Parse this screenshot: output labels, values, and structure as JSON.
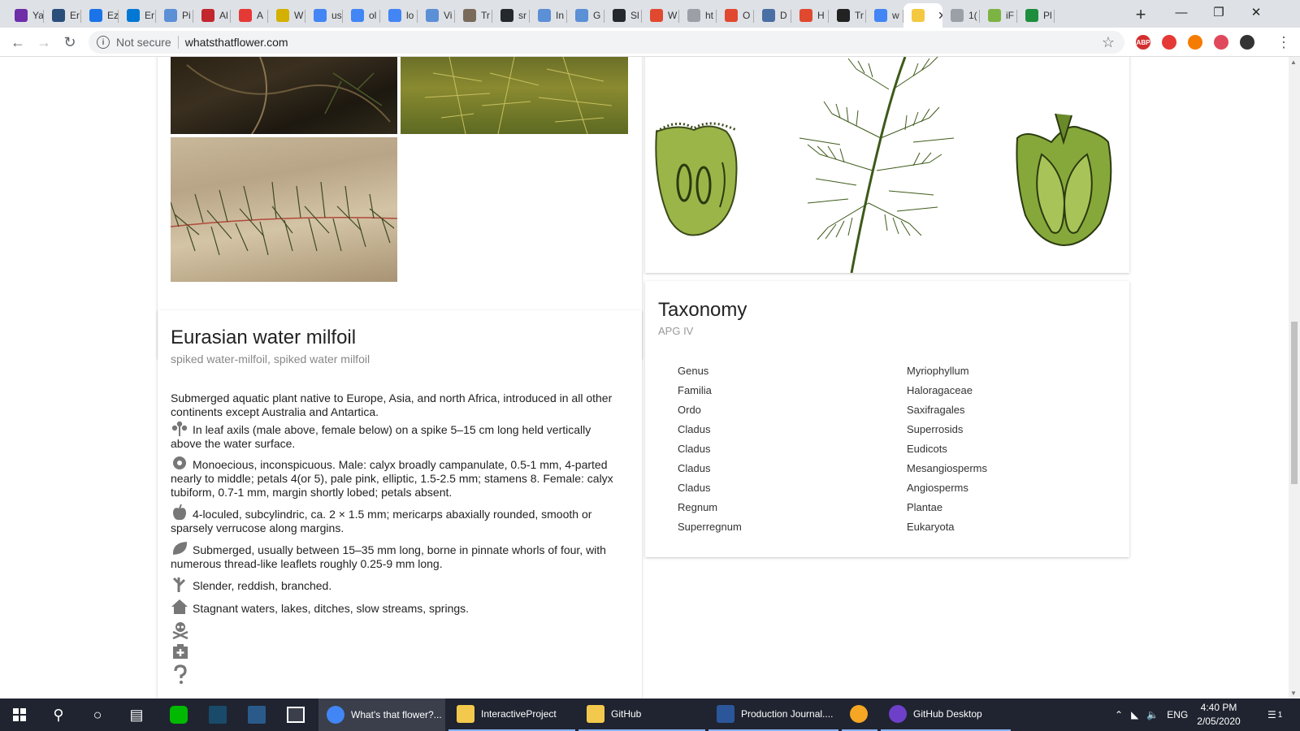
{
  "browser": {
    "tabs": [
      {
        "label": "Ya",
        "color": "#6f2da8"
      },
      {
        "label": "Er",
        "color": "#2a4e7a"
      },
      {
        "label": "Ez",
        "color": "#1a73e8"
      },
      {
        "label": "Er",
        "color": "#0078d4"
      },
      {
        "label": "Pi",
        "color": "#5b8fd6"
      },
      {
        "label": "Al",
        "color": "#c1272d"
      },
      {
        "label": "A",
        "color": "#e53935"
      },
      {
        "label": "W",
        "color": "#d4b000"
      },
      {
        "label": "us",
        "color": "#4285f4"
      },
      {
        "label": "ol",
        "color": "#4285f4"
      },
      {
        "label": "lo",
        "color": "#4285f4"
      },
      {
        "label": "Vi",
        "color": "#5b8fd6"
      },
      {
        "label": "Tr",
        "color": "#7a6a5a"
      },
      {
        "label": "sr",
        "color": "#24292e"
      },
      {
        "label": "In",
        "color": "#5b8fd6"
      },
      {
        "label": "G",
        "color": "#5b8fd6"
      },
      {
        "label": "Sl",
        "color": "#24292e"
      },
      {
        "label": "W",
        "color": "#e0492f"
      },
      {
        "label": "ht",
        "color": "#9aa0a6"
      },
      {
        "label": "O",
        "color": "#e0492f"
      },
      {
        "label": "D",
        "color": "#4a6fa5"
      },
      {
        "label": "H",
        "color": "#e0492f"
      },
      {
        "label": "Tr",
        "color": "#222"
      },
      {
        "label": "w",
        "color": "#4285f4"
      },
      {
        "label": "",
        "color": "#f5c842"
      },
      {
        "label": "1(",
        "color": "#9aa0a6"
      },
      {
        "label": "iF",
        "color": "#7cb342"
      },
      {
        "label": "Pl",
        "color": "#1e8e3e"
      }
    ],
    "active_tab_index": 24,
    "new_tab": "+",
    "security_label": "Not secure",
    "url": "whatsthatflower.com",
    "extensions": [
      {
        "label": "ABP",
        "color": "#d32f2f"
      },
      {
        "label": "",
        "color": "#e53935"
      },
      {
        "label": "",
        "color": "#f57c00"
      },
      {
        "label": "",
        "color": "#e0495b"
      },
      {
        "label": "",
        "color": "#333"
      }
    ]
  },
  "plant": {
    "name": "Eurasian water milfoil",
    "synonyms": "spiked water-milfoil, spiked water milfoil",
    "intro": "Submerged aquatic plant native to Europe, Asia, and north Africa, introduced in all other continents except Australia and Antartica.",
    "features": [
      {
        "icon": "inflorescence-icon",
        "text": "In leaf axils (male above, female below) on a spike 5–15 cm long held vertically above the water surface."
      },
      {
        "icon": "flower-icon",
        "text": "Monoecious, inconspicuous. Male: calyx broadly campanulate, 0.5-1 mm, 4-parted nearly to middle; petals 4(or 5), pale pink, elliptic, 1.5-2.5 mm; stamens 8. Female: calyx tubiform, 0.7-1 mm, margin shortly lobed; petals absent."
      },
      {
        "icon": "fruit-icon",
        "text": "4-loculed, subcylindric, ca. 2 × 1.5 mm; mericarps abaxially rounded, smooth or sparsely verrucose along margins."
      },
      {
        "icon": "leaf-icon",
        "text": "Submerged, usually between 15–35 mm long, borne in pinnate whorls of four, with numerous thread-like leaflets roughly 0.25-9 mm long."
      },
      {
        "icon": "stem-icon",
        "text": "Slender, reddish, branched."
      },
      {
        "icon": "habitat-icon",
        "text": "Stagnant waters, lakes, ditches, slow streams, springs."
      }
    ],
    "empty_icons": [
      "toxicity-icon",
      "medicinal-icon",
      "unknown-icon"
    ]
  },
  "taxonomy": {
    "title": "Taxonomy",
    "system": "APG IV",
    "rows": [
      {
        "rank": "Genus",
        "name": "Myriophyllum"
      },
      {
        "rank": "Familia",
        "name": "Haloragaceae"
      },
      {
        "rank": "Ordo",
        "name": "Saxifragales"
      },
      {
        "rank": "Cladus",
        "name": "Superrosids"
      },
      {
        "rank": "Cladus",
        "name": "Eudicots"
      },
      {
        "rank": "Cladus",
        "name": "Mesangiosperms"
      },
      {
        "rank": "Cladus",
        "name": "Angiosperms"
      },
      {
        "rank": "Regnum",
        "name": "Plantae"
      },
      {
        "rank": "Superregnum",
        "name": "Eukaryota"
      }
    ]
  },
  "taskbar": {
    "apps": [
      {
        "label": "What's that flower?...",
        "color": "#4285f4",
        "state": "active"
      },
      {
        "label": "InteractiveProject",
        "color": "#f2c94c",
        "state": "open"
      },
      {
        "label": "GitHub",
        "color": "#f2c94c",
        "state": "open"
      },
      {
        "label": "Production Journal....",
        "color": "#2b579a",
        "state": "open"
      },
      {
        "label": "",
        "color": "#f5a623",
        "state": "open"
      },
      {
        "label": "GitHub Desktop",
        "color": "#6e40c9",
        "state": "open"
      }
    ],
    "language": "ENG",
    "time": "4:40 PM",
    "date": "2/05/2020",
    "notification_count": "1"
  }
}
